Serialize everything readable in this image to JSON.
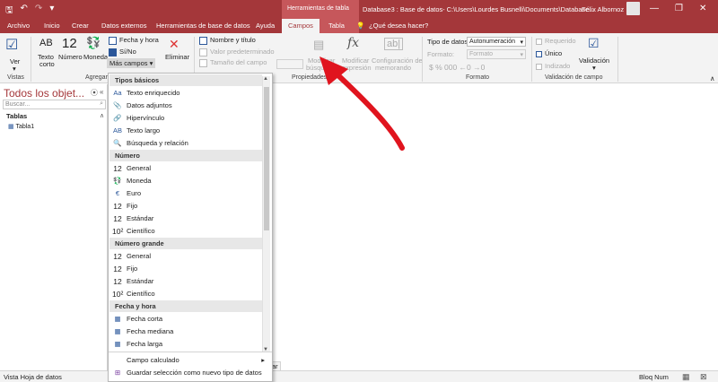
{
  "titlebar": {
    "context_label": "Herramientas de tabla",
    "window_title": "Database3 : Base de datos- C:\\Users\\Lourdes Busnelli\\Documents\\Database...",
    "user_name": "Félix Albornoz",
    "qat": [
      "save-icon",
      "undo-icon",
      "redo-icon",
      "customize-icon"
    ],
    "window_buttons": [
      "minimize",
      "restore",
      "close"
    ]
  },
  "tabs": {
    "archivo": "Archivo",
    "inicio": "Inicio",
    "crear": "Crear",
    "datos_externos": "Datos externos",
    "herramientas_bd": "Herramientas de base de datos",
    "ayuda": "Ayuda",
    "campos": "Campos",
    "tabla": "Tabla",
    "tell_me": "¿Qué desea hacer?"
  },
  "ribbon": {
    "ver": "Ver",
    "texto_corto": [
      "Texto",
      "corto"
    ],
    "numero": "Número",
    "numero_glyph": "12",
    "moneda": "Moneda",
    "fecha_hora": "Fecha y hora",
    "si_no": "Sí/No",
    "mas_campos": "Más campos",
    "eliminar": "Eliminar",
    "nombre_titulo": "Nombre y título",
    "valor_predeterminado": "Valor predeterminado",
    "tamano_campo": "Tamaño del campo",
    "modificar_busquedas": [
      "Modificar",
      "búsquedas"
    ],
    "modificar_expresion": [
      "Modificar",
      "expresión"
    ],
    "configuracion_memorando": [
      "Configuración de",
      "memorando"
    ],
    "tipo_datos_label": "Tipo de datos:",
    "tipo_datos_value": "Autonumeración",
    "formato_label": "Formato:",
    "formato_value": "Formato",
    "requerido": "Requerido",
    "unico": "Único",
    "indexado": "Indizado",
    "validacion": "Validación",
    "groups": {
      "vistas": "Vistas",
      "agregar": "Agregar",
      "propiedades": "Propiedades",
      "formato": "Formato",
      "validacion": "Validación de campo"
    }
  },
  "nav": {
    "title": "Todos los objet...",
    "search_placeholder": "Buscar...",
    "section": "Tablas",
    "items": [
      "Tabla1"
    ]
  },
  "dropdown": {
    "sections": {
      "basicos": "Tipos básicos",
      "numero": "Número",
      "numero_grande": "Número grande",
      "fecha_hora": "Fecha y hora"
    },
    "basicos": [
      {
        "glyph": "Aa",
        "label": "Texto enriquecido"
      },
      {
        "glyph": "📎",
        "label": "Datos adjuntos"
      },
      {
        "glyph": "🔗",
        "label": "Hipervínculo"
      },
      {
        "glyph": "AB",
        "label": "Texto largo"
      },
      {
        "glyph": "🔍",
        "label": "Búsqueda y relación"
      }
    ],
    "numero": [
      {
        "glyph": "12",
        "label": "General"
      },
      {
        "glyph": "💱",
        "label": "Moneda"
      },
      {
        "glyph": "€",
        "label": "Euro"
      },
      {
        "glyph": "12",
        "label": "Fijo"
      },
      {
        "glyph": "12",
        "label": "Estándar"
      },
      {
        "glyph": "10²",
        "label": "Científico"
      }
    ],
    "numero_grande": [
      {
        "glyph": "12",
        "label": "General"
      },
      {
        "glyph": "12",
        "label": "Fijo"
      },
      {
        "glyph": "12",
        "label": "Estándar"
      },
      {
        "glyph": "10²",
        "label": "Científico"
      }
    ],
    "fecha_hora": [
      {
        "glyph": "▦",
        "label": "Fecha corta"
      },
      {
        "glyph": "▦",
        "label": "Fecha mediana"
      },
      {
        "glyph": "▦",
        "label": "Fecha larga"
      }
    ],
    "campo_calculado": "Campo calculado",
    "guardar_seleccion": "Guardar selección como nuevo tipo de datos"
  },
  "workspace": {
    "bottom_tab_fragment": "ar"
  },
  "statusbar": {
    "left": "Vista Hoja de datos",
    "bloq_num": "Bloq Num"
  },
  "colors": {
    "accent": "#a4373a",
    "ctx_tab": "#c6575b",
    "arrow": "#e0141e"
  }
}
